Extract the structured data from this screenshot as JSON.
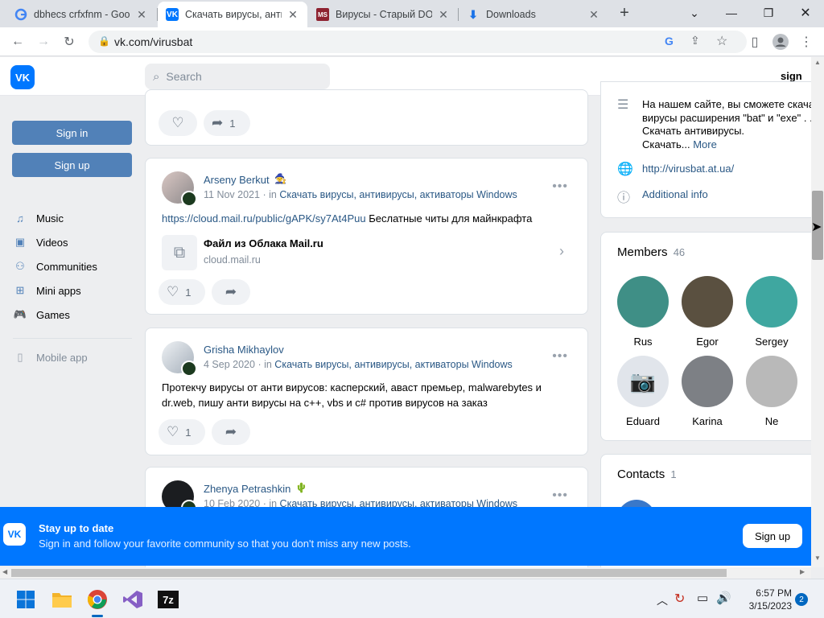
{
  "browser": {
    "tabs": [
      {
        "label": "dbhecs crfxfnm - Goog",
        "icon": "google-g"
      },
      {
        "label": "Скачать вирусы, антив",
        "icon": "vk"
      },
      {
        "label": "Вирусы - Старый DOS",
        "icon": "ms"
      },
      {
        "label": "Downloads",
        "icon": "download"
      }
    ],
    "new_tab": "+",
    "url": "vk.com/virusbat"
  },
  "header": {
    "logo": "VK",
    "search_placeholder": "Search",
    "sign_up": "sign up"
  },
  "sidebar": {
    "sign_in": "Sign in",
    "sign_up": "Sign up",
    "nav": [
      {
        "label": "Music",
        "icon": "music-icon"
      },
      {
        "label": "Videos",
        "icon": "videos-icon"
      },
      {
        "label": "Communities",
        "icon": "communities-icon"
      },
      {
        "label": "Mini apps",
        "icon": "mini-apps-icon"
      },
      {
        "label": "Games",
        "icon": "games-icon"
      }
    ],
    "mobile_app": "Mobile app"
  },
  "feed": {
    "top_post": {
      "share_count": "1"
    },
    "posts": [
      {
        "author": "Arseny Berkut",
        "date": "11 Nov 2021",
        "in_label": "in",
        "community": "Скачать вирусы, антивирусы, активаторы Windows",
        "link_text": "https://cloud.mail.ru/public/gAPK/sy7At4Puu",
        "text": " Беслатные читы для майнкрафта",
        "attachment_title": "Файл из Облака Mail.ru",
        "attachment_domain": "cloud.mail.ru",
        "likes": "1"
      },
      {
        "author": "Grisha Mikhaylov",
        "date": "4 Sep 2020",
        "in_label": "in",
        "community": "Скачать вирусы, антивирусы, активаторы Windows",
        "text_line1": "Протекчу вирусы от анти вирусов: касперский, аваст премьер, malwarebytes и",
        "text_line2": "dr.web, пишу анти вирусы на c++, vbs и c# против вирусов на заказ",
        "likes": "1"
      },
      {
        "author": "Zhenya Petrashkin",
        "date": "10 Feb 2020",
        "in_label": "in",
        "community": "Скачать вирусы, антивирусы, активаторы Windows"
      }
    ]
  },
  "info": {
    "description_line1": "На нашем сайте, вы сможете скача",
    "description_line2": "вирусы расширения \"bat\" и \"exe\" . .",
    "description_line3": "Скачать антивирусы.",
    "description_line4": "Скачать...",
    "more": "More",
    "website": "http://virusbat.at.ua/",
    "additional": "Additional info"
  },
  "members": {
    "title": "Members",
    "count": "46",
    "list": [
      {
        "name": "Rus",
        "color": "#3f8f86"
      },
      {
        "name": "Egor",
        "color": "#5a5040"
      },
      {
        "name": "Sergey",
        "color": "#3fa7a0"
      },
      {
        "name": "Eduard",
        "color": "#e1e5eb"
      },
      {
        "name": "Karina",
        "color": "#7d8085"
      },
      {
        "name": "Ne",
        "color": "#b9b9b9"
      }
    ]
  },
  "contacts": {
    "title": "Contacts",
    "count": "1"
  },
  "banner": {
    "title": "Stay up to date",
    "subtitle": "Sign in and follow your favorite community so that you don't miss any new posts.",
    "button": "Sign up"
  },
  "taskbar": {
    "time": "6:57 PM",
    "date": "3/15/2023",
    "notifications": "2",
    "sevenzip_label": "7z"
  },
  "colors": {
    "vk_blue": "#0077ff",
    "link": "#2a5885",
    "button": "#5181b8"
  }
}
